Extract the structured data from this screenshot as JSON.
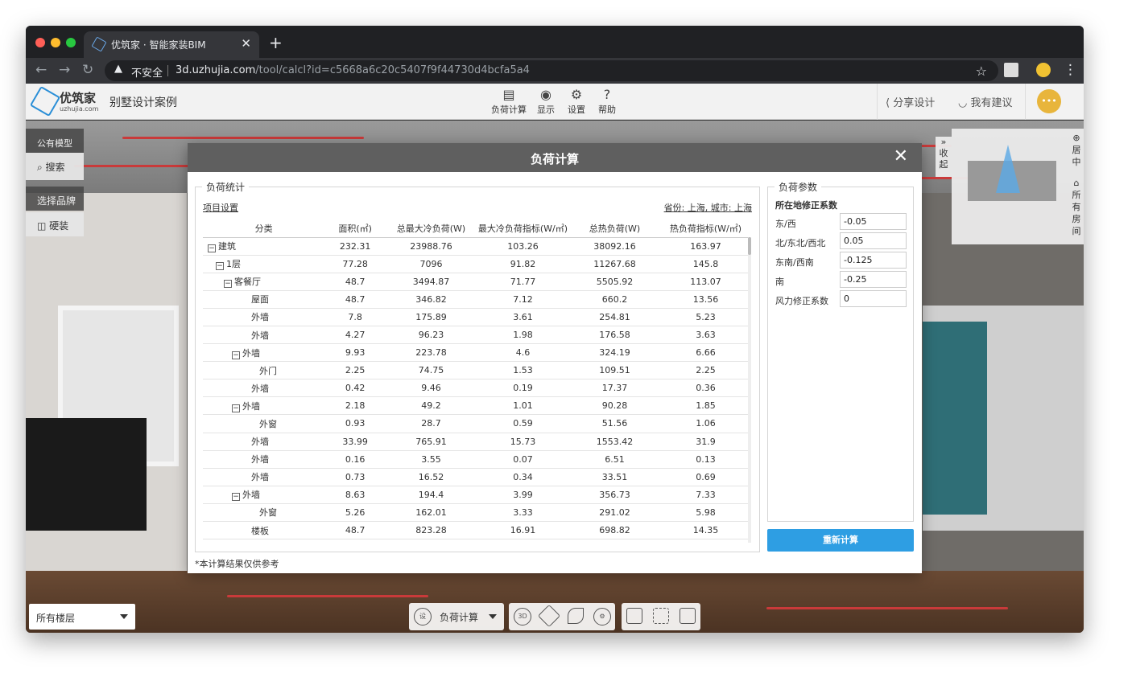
{
  "browser": {
    "tab_title": "优筑家 · 智能家装BIM",
    "security_label": "不安全",
    "url_host": "3d.uzhujia.com",
    "url_path": "/tool/calcl?id=c5668a6c20c5407f9f44730d4bcfa5a4"
  },
  "app": {
    "logo_name": "优筑家",
    "logo_domain": "uzhujia.com",
    "project_title": "别墅设计案例",
    "tools": [
      {
        "label": "负荷计算",
        "icon": "clipboard-icon"
      },
      {
        "label": "显示",
        "icon": "eye-icon"
      },
      {
        "label": "设置",
        "icon": "gear-icon"
      },
      {
        "label": "帮助",
        "icon": "help-icon"
      }
    ],
    "share_label": "分享设计",
    "feedback_label": "我有建议"
  },
  "left_panel": {
    "public_models": "公有模型",
    "search": "搜索",
    "select_brand": "选择品牌",
    "hardware": "硬装"
  },
  "minimap": {
    "collapse": "收起",
    "center": "居中",
    "all_rooms": "所有房间"
  },
  "bottom": {
    "floor_select": "所有楼层",
    "calc_select": "负荷计算",
    "set_icon_text": "设",
    "view_3d_text": "3D"
  },
  "modal": {
    "title": "负荷计算",
    "stats_legend": "负荷统计",
    "project_settings": "项目设置",
    "location": "省份: 上海, 城市: 上海",
    "columns": [
      "分类",
      "面积(㎡)",
      "总最大冷负荷(W)",
      "最大冷负荷指标(W/㎡)",
      "总热负荷(W)",
      "热负荷指标(W/㎡)"
    ],
    "rows": [
      {
        "name": "建筑",
        "level": 0,
        "toggle": "−",
        "area": "232.31",
        "cool": "23988.76",
        "cool_idx": "103.26",
        "heat": "38092.16",
        "heat_idx": "163.97"
      },
      {
        "name": "1层",
        "level": 1,
        "toggle": "−",
        "area": "77.28",
        "cool": "7096",
        "cool_idx": "91.82",
        "heat": "11267.68",
        "heat_idx": "145.8"
      },
      {
        "name": "客餐厅",
        "level": 2,
        "toggle": "−",
        "area": "48.7",
        "cool": "3494.87",
        "cool_idx": "71.77",
        "heat": "5505.92",
        "heat_idx": "113.07"
      },
      {
        "name": "屋面",
        "level": 3,
        "toggle": "",
        "area": "48.7",
        "cool": "346.82",
        "cool_idx": "7.12",
        "heat": "660.2",
        "heat_idx": "13.56"
      },
      {
        "name": "外墙",
        "level": 3,
        "toggle": "",
        "area": "7.8",
        "cool": "175.89",
        "cool_idx": "3.61",
        "heat": "254.81",
        "heat_idx": "5.23"
      },
      {
        "name": "外墙",
        "level": 3,
        "toggle": "",
        "area": "4.27",
        "cool": "96.23",
        "cool_idx": "1.98",
        "heat": "176.58",
        "heat_idx": "3.63"
      },
      {
        "name": "外墙",
        "level": 3,
        "toggle": "−",
        "area": "9.93",
        "cool": "223.78",
        "cool_idx": "4.6",
        "heat": "324.19",
        "heat_idx": "6.66"
      },
      {
        "name": "外门",
        "level": 4,
        "toggle": "",
        "area": "2.25",
        "cool": "74.75",
        "cool_idx": "1.53",
        "heat": "109.51",
        "heat_idx": "2.25"
      },
      {
        "name": "外墙",
        "level": 3,
        "toggle": "",
        "area": "0.42",
        "cool": "9.46",
        "cool_idx": "0.19",
        "heat": "17.37",
        "heat_idx": "0.36"
      },
      {
        "name": "外墙",
        "level": 3,
        "toggle": "−",
        "area": "2.18",
        "cool": "49.2",
        "cool_idx": "1.01",
        "heat": "90.28",
        "heat_idx": "1.85"
      },
      {
        "name": "外窗",
        "level": 4,
        "toggle": "",
        "area": "0.93",
        "cool": "28.7",
        "cool_idx": "0.59",
        "heat": "51.56",
        "heat_idx": "1.06"
      },
      {
        "name": "外墙",
        "level": 3,
        "toggle": "",
        "area": "33.99",
        "cool": "765.91",
        "cool_idx": "15.73",
        "heat": "1553.42",
        "heat_idx": "31.9"
      },
      {
        "name": "外墙",
        "level": 3,
        "toggle": "",
        "area": "0.16",
        "cool": "3.55",
        "cool_idx": "0.07",
        "heat": "6.51",
        "heat_idx": "0.13"
      },
      {
        "name": "外墙",
        "level": 3,
        "toggle": "",
        "area": "0.73",
        "cool": "16.52",
        "cool_idx": "0.34",
        "heat": "33.51",
        "heat_idx": "0.69"
      },
      {
        "name": "外墙",
        "level": 3,
        "toggle": "−",
        "area": "8.63",
        "cool": "194.4",
        "cool_idx": "3.99",
        "heat": "356.73",
        "heat_idx": "7.33"
      },
      {
        "name": "外窗",
        "level": 4,
        "toggle": "",
        "area": "5.26",
        "cool": "162.01",
        "cool_idx": "3.33",
        "heat": "291.02",
        "heat_idx": "5.98"
      },
      {
        "name": "楼板",
        "level": 3,
        "toggle": "",
        "area": "48.7",
        "cool": "823.28",
        "cool_idx": "16.91",
        "heat": "698.82",
        "heat_idx": "14.35"
      }
    ],
    "note": "*本计算结果仅供参考",
    "params_legend": "负荷参数",
    "params_title": "所在地修正系数",
    "params": [
      {
        "label": "东/西",
        "value": "-0.05"
      },
      {
        "label": "北/东北/西北",
        "value": "0.05"
      },
      {
        "label": "东南/西南",
        "value": "-0.125"
      },
      {
        "label": "南",
        "value": "-0.25"
      },
      {
        "label": "风力修正系数",
        "value": "0"
      }
    ],
    "recalc_label": "重新计算"
  }
}
